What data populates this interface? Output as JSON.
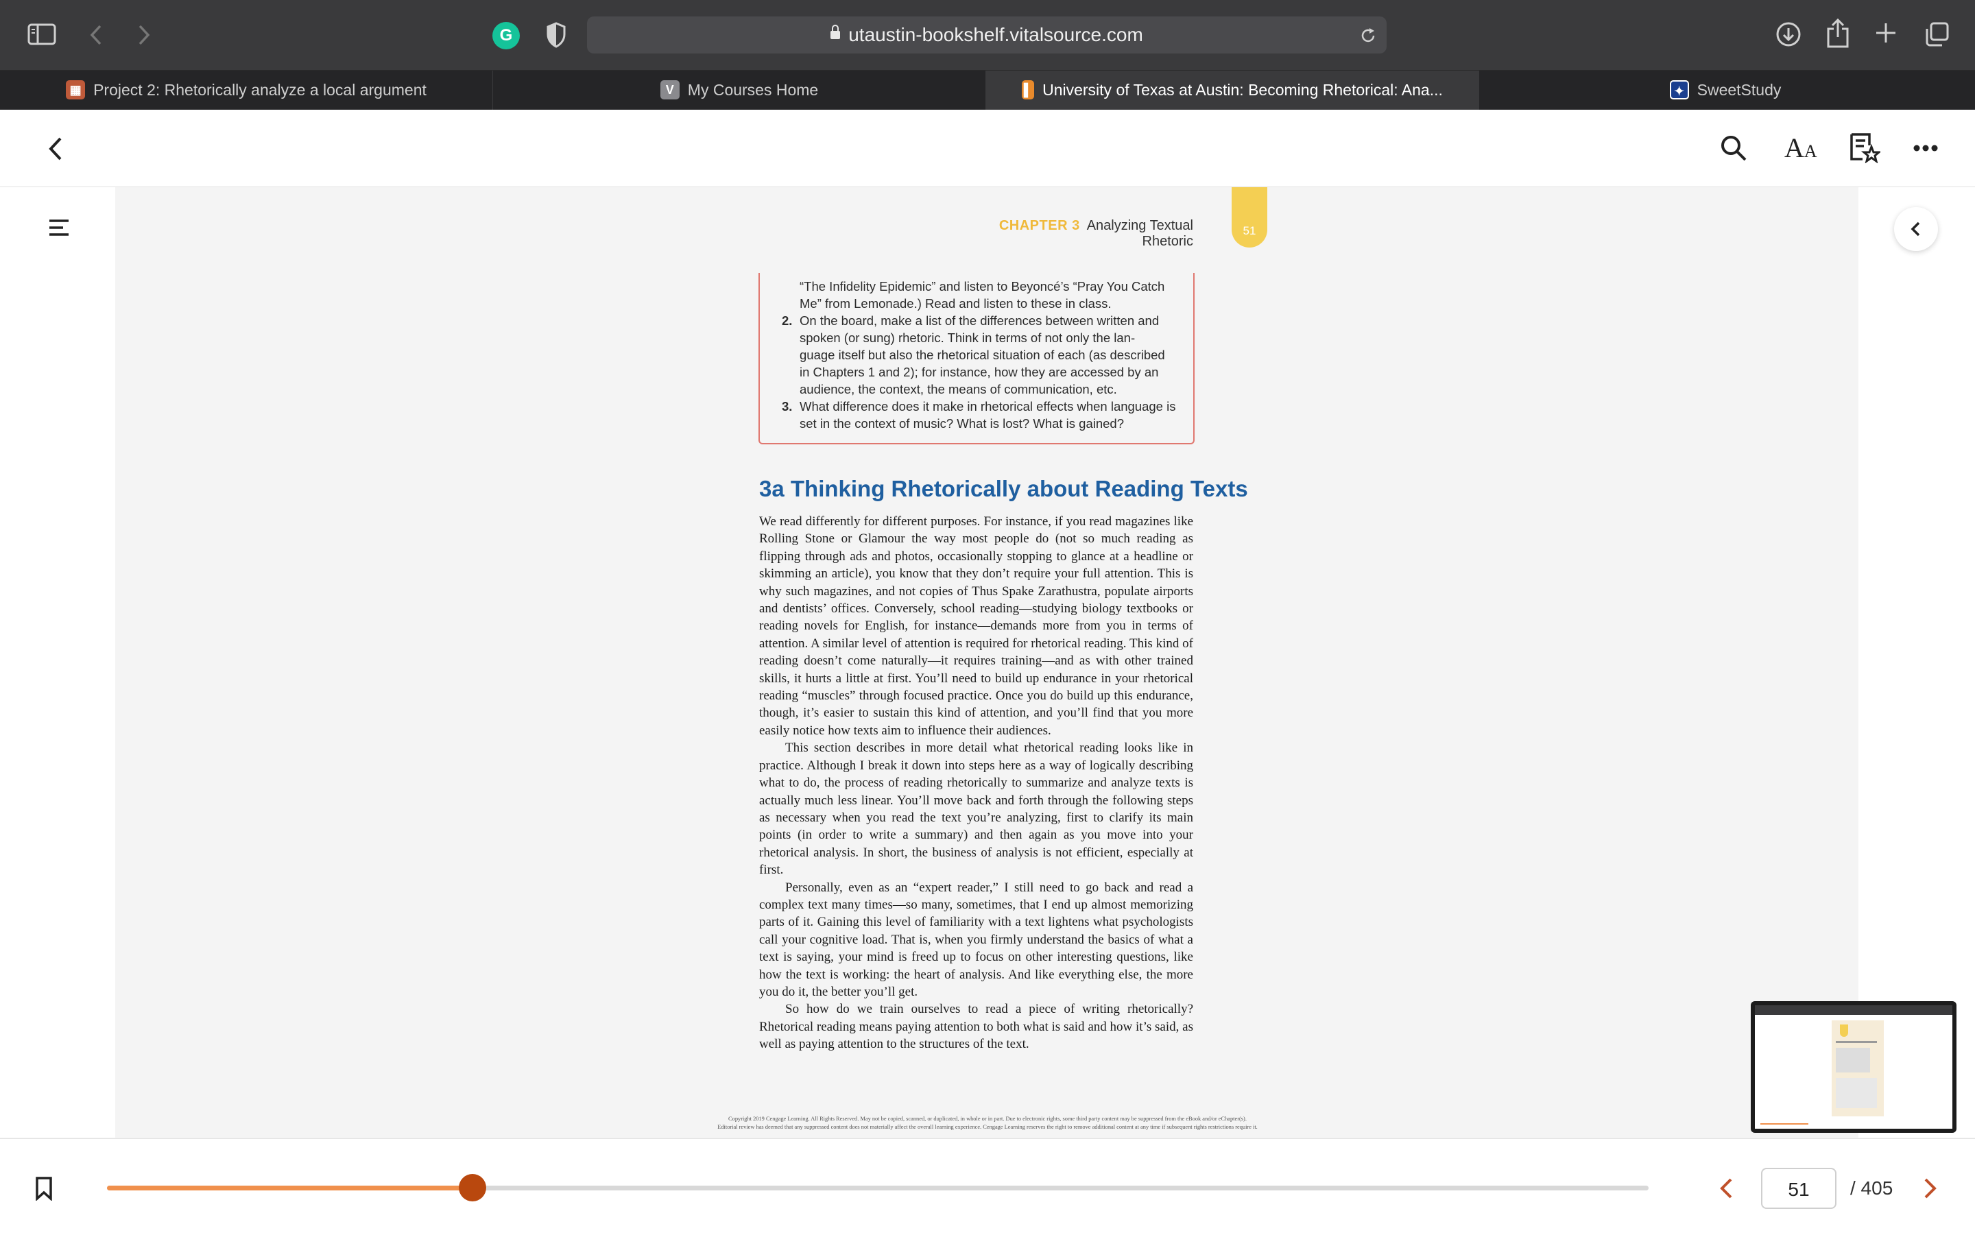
{
  "browser": {
    "url": "utaustin-bookshelf.vitalsource.com",
    "tabs": [
      {
        "label": "Project 2: Rhetorically analyze a local argument",
        "icon": "project-tab-icon",
        "active": false
      },
      {
        "label": "My Courses Home",
        "icon": "vitalsource-tab-icon",
        "active": false
      },
      {
        "label": "University of Texas at Austin: Becoming Rhetorical: Ana...",
        "icon": "book-tab-icon",
        "active": true
      },
      {
        "label": "SweetStudy",
        "icon": "sweetstudy-tab-icon",
        "active": false
      }
    ],
    "extension_letter": "G"
  },
  "page": {
    "chapter_label": "CHAPTER 3",
    "chapter_title": "Analyzing Textual Rhetoric",
    "page_number": "51",
    "exercise_lines": [
      {
        "num": "",
        "text": "“The Infidelity Epidemic” and listen to Beyoncé’s “Pray You Catch"
      },
      {
        "num": "",
        "text": "Me” from Lemonade.) Read and listen to these in class."
      },
      {
        "num": "2.",
        "text": "On the board, make a list of the differences between written and"
      },
      {
        "num": "",
        "text": "spoken (or sung) rhetoric. Think in terms of not only the lan-"
      },
      {
        "num": "",
        "text": "guage itself but also the rhetorical situation of each (as described"
      },
      {
        "num": "",
        "text": "in Chapters 1 and 2); for instance, how they are accessed by an"
      },
      {
        "num": "",
        "text": "audience, the context, the means of communication, etc."
      },
      {
        "num": "3.",
        "text": "What difference does it make in rhetorical effects when language is"
      },
      {
        "num": "",
        "text": "set in the context of music? What is lost? What is gained?"
      }
    ],
    "section_title": "3a Thinking Rhetorically about Reading Texts",
    "paragraphs": [
      "We read differently for different purposes. For instance, if you read magazines like Rolling Stone or Glamour the way most people do (not so much reading as flipping through ads and photos, occasionally stopping to glance at a headline or skimming an article), you know that they don’t require your full attention. This is why such magazines, and not copies of Thus Spake Zarathustra, populate airports and dentists’ offices. Conversely, school reading—studying biology textbooks or reading novels for English, for instance—demands more from you in terms of attention. A similar level of attention is required for rhetorical reading. This kind of reading doesn’t come naturally—it requires training—and as with other trained skills, it hurts a little at first. You’ll need to build up endurance in your rhetorical reading “muscles” through focused practice. Once you do build up this endurance, though, it’s easier to sustain this kind of attention, and you’ll find that you more easily notice how texts aim to influence their audiences.",
      "This section describes in more detail what rhetorical reading looks like in practice. Although I break it down into steps here as a way of logically describing what to do, the process of reading rhetorically to summarize and analyze texts is actually much less linear. You’ll move back and forth through the following steps as necessary when you read the text you’re analyzing, first to clarify its main points (in order to write a summary) and then again as you move into your rhetorical analysis. In short, the business of analysis is not efficient, especially at first.",
      "Personally, even as an “expert reader,” I still need to go back and read a complex text many times—so many, sometimes, that I end up almost memorizing parts of it. Gaining this level of familiarity with a text lightens what psychologists call your cognitive load. That is, when you firmly understand the basics of what a text is saying, your mind is freed up to focus on other interesting questions, like how the text is working: the heart of analysis. And like everything else, the more you do it, the better you’ll get.",
      "So how do we train ourselves to read a piece of writing rhetorically? Rhetorical reading means paying attention to both what is said and how it’s said, as well as paying attention to the structures of the text."
    ],
    "copyright_line1": "Copyright 2019 Cengage Learning. All Rights Reserved. May not be copied, scanned, or duplicated, in whole or in part. Due to electronic rights, some third party content may be suppressed from the eBook and/or eChapter(s).",
    "copyright_line2": "Editorial review has deemed that any suppressed content does not materially affect the overall learning experience. Cengage Learning reserves the right to remove additional content at any time if subsequent rights restrictions require it."
  },
  "footer": {
    "current_page": "51",
    "total_pages": "/ 405",
    "progress": 0.237
  },
  "colors": {
    "accent": "#b9480e",
    "progress_fill": "#f0904c",
    "chapter": "#f0b93a",
    "section_title": "#1f5fa0",
    "exercise_border": "#e07870"
  }
}
